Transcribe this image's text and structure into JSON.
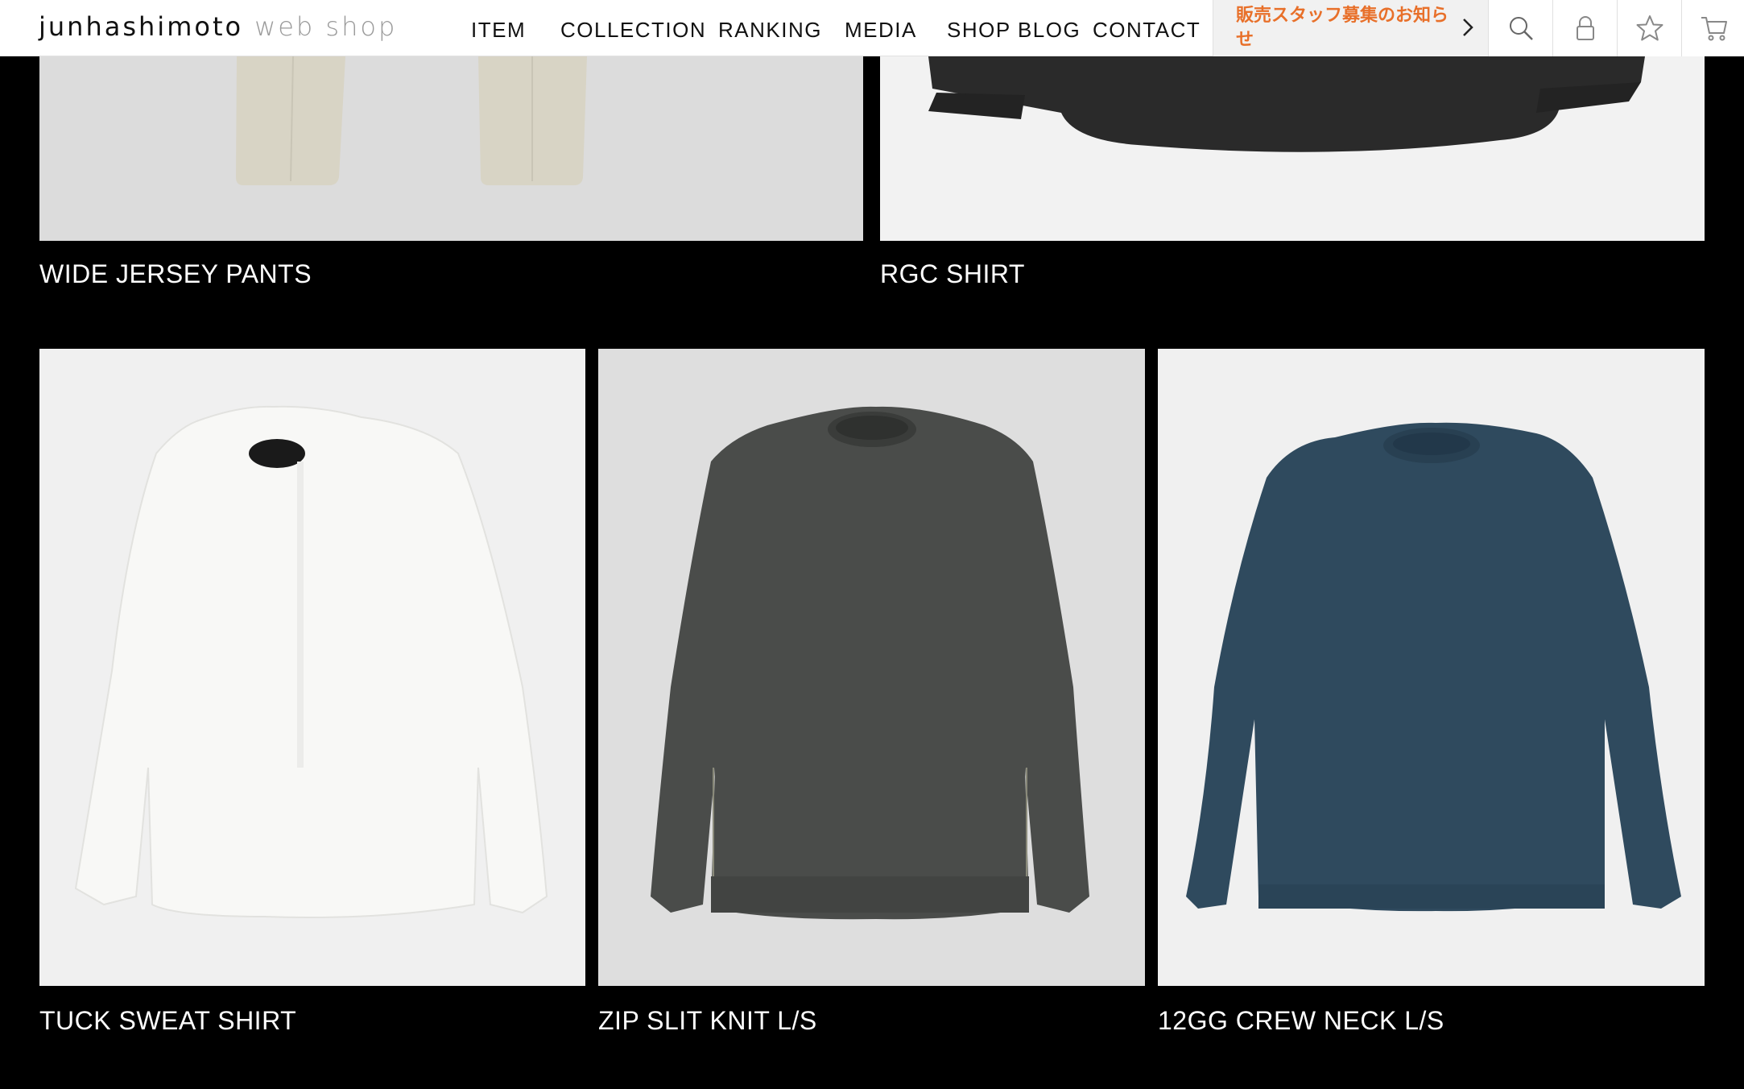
{
  "header": {
    "logo_brand": "junhashimoto",
    "logo_sub": "web shop",
    "nav": [
      "ITEM",
      "COLLECTION",
      "RANKING",
      "MEDIA",
      "SHOP BLOG",
      "CONTACT"
    ],
    "notice_text": "販売スタッフ募集のお知らせ",
    "notice_color": "#e8702a",
    "icons": [
      "search-icon",
      "lock-icon",
      "star-icon",
      "cart-icon"
    ]
  },
  "products": [
    {
      "name": "WIDE JERSEY PANTS",
      "bg": "#dcdcdc",
      "item_color": "#d8d4c5"
    },
    {
      "name": "RGC SHIRT",
      "bg": "#f2f2f2",
      "item_color": "#2a2a2a"
    },
    {
      "name": "TUCK SWEAT SHIRT",
      "bg": "#f0f0f0",
      "item_color": "#f7f7f5"
    },
    {
      "name": "ZIP SLIT KNIT L/S",
      "bg": "#dedede",
      "item_color": "#4a4c4a"
    },
    {
      "name": "12GG CREW NECK L/S",
      "bg": "#f0f0f0",
      "item_color": "#2f4a5e"
    }
  ]
}
